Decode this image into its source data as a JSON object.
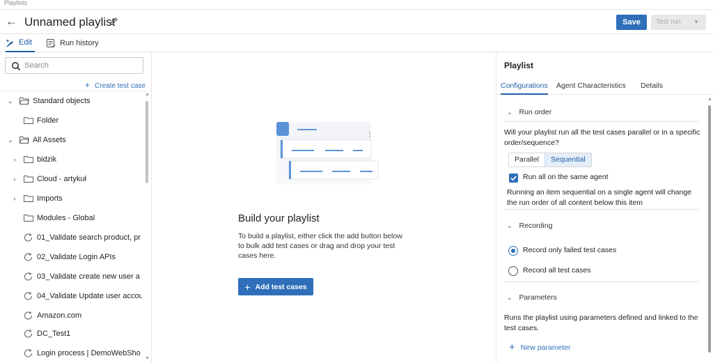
{
  "breadcrumb": "Playlists",
  "header": {
    "title": "Unnamed playlist",
    "save_label": "Save",
    "test_run_label": "Test run"
  },
  "tabs": [
    {
      "label": "Edit",
      "icon": "edit-icon",
      "active": true
    },
    {
      "label": "Run history",
      "icon": "history-icon",
      "active": false
    }
  ],
  "sidebar": {
    "search_placeholder": "Search",
    "create_label": "Create test case",
    "tree": [
      {
        "label": "Standard objects",
        "type": "folder",
        "expanded": true
      },
      {
        "label": "Folder",
        "type": "folder"
      },
      {
        "label": "All Assets",
        "type": "folder",
        "expanded": true
      },
      {
        "label": "bidzik",
        "type": "folder",
        "expandable": true
      },
      {
        "label": "Cloud - artykuł",
        "type": "folder",
        "expandable": true
      },
      {
        "label": "Imports",
        "type": "folder",
        "expandable": true
      },
      {
        "label": "Modules - Global",
        "type": "folder"
      },
      {
        "label": "01_Validate search product, pr",
        "type": "test"
      },
      {
        "label": "02_Validate Login APIs",
        "type": "test"
      },
      {
        "label": "03_Validate create new user a",
        "type": "test"
      },
      {
        "label": "04_Validate Update user accou",
        "type": "test"
      },
      {
        "label": "Amazon.com",
        "type": "test"
      },
      {
        "label": "DC_Test1",
        "type": "test"
      },
      {
        "label": "Login process | DemoWebSho",
        "type": "test"
      }
    ]
  },
  "main": {
    "empty_title": "Build your playlist",
    "empty_description": "To build a playlist, either click the add button below to bulk add test cases or drag and drop your test cases here.",
    "add_button_label": "Add test cases"
  },
  "panel": {
    "title": "Playlist",
    "tabs": [
      "Configurations",
      "Agent Characteristics",
      "Details"
    ],
    "run_order": {
      "heading": "Run order",
      "question": "Will your playlist run all the test cases parallel or in a specific order/sequence?",
      "options": [
        "Parallel",
        "Sequential"
      ],
      "selected": "Sequential",
      "same_agent_label": "Run all on the same agent",
      "same_agent_checked": true,
      "note": "Running an item sequential on a single agent will change the run order of all content below this item"
    },
    "recording": {
      "heading": "Recording",
      "options": [
        "Record only failed test cases",
        "Record all test cases"
      ],
      "selected": "Record only failed test cases"
    },
    "parameters": {
      "heading": "Parameters",
      "description": "Runs the playlist using parameters defined and linked to the test cases.",
      "new_label": "New parameter"
    }
  },
  "colors": {
    "accent": "#2f6fb9",
    "selected_bg": "#e4edf8"
  }
}
